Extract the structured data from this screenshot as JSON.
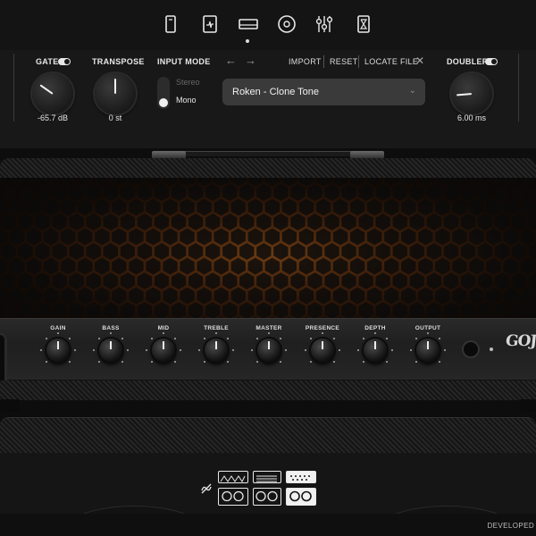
{
  "nav": {
    "icons": [
      "preset-page-icon",
      "tuner-icon",
      "amp-head-icon",
      "cd-player-icon",
      "mixer-sliders-icon",
      "metronome-hourglass-icon"
    ],
    "active_index": 2
  },
  "gate": {
    "label": "GATE",
    "value": "-65.7 dB",
    "enabled": true
  },
  "transpose": {
    "label": "TRANSPOSE",
    "value": "0 st"
  },
  "input_mode": {
    "label": "INPUT MODE",
    "options": [
      "Stereo",
      "Mono"
    ],
    "selected": "Mono"
  },
  "preset_bar": {
    "import_label": "IMPORT",
    "reset_label": "RESET",
    "locate_label": "LOCATE FILE",
    "preset_name": "Roken - Clone Tone"
  },
  "doubler": {
    "label": "DOUBLER",
    "value": "6.00 ms",
    "enabled": true
  },
  "amp": {
    "knobs": [
      "GAIN",
      "BASS",
      "MID",
      "TREBLE",
      "MASTER",
      "PRESENCE",
      "DEPTH",
      "OUTPUT"
    ],
    "logo": "GOJIRA"
  },
  "cab": {
    "active_cab_index": 2
  },
  "footer": {
    "developed_label": "DEVELOPED"
  },
  "colors": {
    "background": "#0d0d0d",
    "panel": "#181818",
    "grille_glow": "#6a3a12",
    "text": "#e8e8e8"
  }
}
